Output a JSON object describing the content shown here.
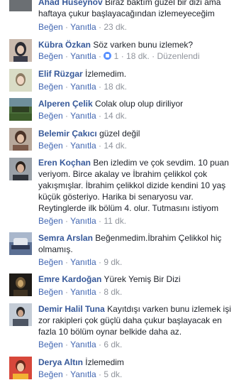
{
  "labels": {
    "like": "Beğen",
    "reply": "Yanıtla",
    "sep": "·",
    "edited": "Düzenlendi"
  },
  "comments": [
    {
      "name": "Ahad Huseynov",
      "text": "Biraz baktım güzel bir dizi ama haftaya çukur başlayacağından izlemeyeceğim",
      "time": "23 dk."
    },
    {
      "name": "Kübra Özkan",
      "text": "Söz varken bunu izlemek?",
      "likes": "1",
      "time": "18 dk."
    },
    {
      "name": "Elif Rüzgar",
      "text": "İzlemedim.",
      "time": "18 dk."
    },
    {
      "name": "Alperen Çelik",
      "text": "Colak olup olup diriliyor",
      "time": "14 dk."
    },
    {
      "name": "Belemir Çakıcı",
      "text": "güzel değil",
      "time": "14 dk."
    },
    {
      "name": "Eren Koçhan",
      "text": "Ben izledim ve çok sevdim. 10 puan veriyom. Birce akalay ve İbrahim çelikkol çok yakışmışlar. İbrahim çelikkol dizide kendini 10 yaş küçük gösteriyo. Harika bi senaryosu var. Reytinglerde ilk bölüm 4. olur. Tutmasını istiyom",
      "time": "11 dk."
    },
    {
      "name": "Semra Arslan",
      "text": "Beğenmedim.İbrahim Çelikkol hiç olmamış.",
      "time": "9 dk."
    },
    {
      "name": "Emre Kardoğan",
      "text": "Yürek Yemiş Bir Dizi",
      "time": "8 dk."
    },
    {
      "name": "Demir Halil Tuna",
      "text": "Kayıtdışı varken bunu izlemek işi zor rakipleri çok güçlü daha çukur başlayacak en fazla 10 bölüm oynar belkide daha az.",
      "time": "6 dk."
    },
    {
      "name": "Derya Altın",
      "text": "İzlemedim",
      "time": "5 dk."
    }
  ]
}
